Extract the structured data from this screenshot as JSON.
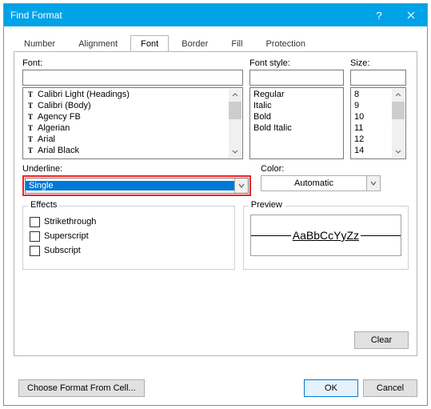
{
  "window": {
    "title": "Find Format"
  },
  "tabs": [
    "Number",
    "Alignment",
    "Font",
    "Border",
    "Fill",
    "Protection"
  ],
  "active_tab": "Font",
  "labels": {
    "font": "Font:",
    "font_style": "Font style:",
    "size": "Size:",
    "underline": "Underline:",
    "color": "Color:",
    "effects": "Effects",
    "preview": "Preview",
    "strike": "Strikethrough",
    "super": "Superscript",
    "sub": "Subscript"
  },
  "fonts": [
    "Calibri Light (Headings)",
    "Calibri (Body)",
    "Agency FB",
    "Algerian",
    "Arial",
    "Arial Black"
  ],
  "font_styles": [
    "Regular",
    "Italic",
    "Bold",
    "Bold Italic"
  ],
  "sizes": [
    "8",
    "9",
    "10",
    "11",
    "12",
    "14"
  ],
  "underline": {
    "value": "Single"
  },
  "color": {
    "value": "Automatic"
  },
  "preview_text": "AaBbCcYyZz",
  "buttons": {
    "clear": "Clear",
    "choose": "Choose Format From Cell...",
    "ok": "OK",
    "cancel": "Cancel"
  }
}
